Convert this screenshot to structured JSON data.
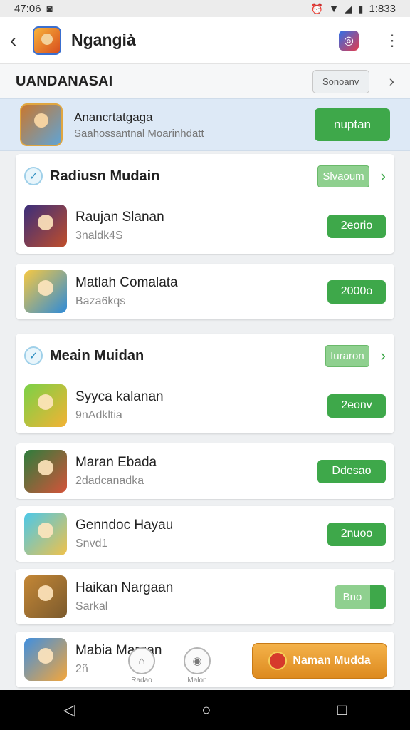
{
  "status": {
    "time": "47:06",
    "battery": "1:833"
  },
  "app_bar": {
    "title": "Ngangià"
  },
  "section": {
    "title": "UANDANASAI",
    "sort_label": "Sonoanv"
  },
  "featured": {
    "title": "Anancrtatgaga",
    "subtitle": "Saahossantnal Moarinhdatt",
    "button": "nuptan"
  },
  "groups": [
    {
      "title": "Radiusn Mudain",
      "badge": "Slvaoum",
      "items": [
        {
          "name": "Raujan Slanan",
          "sub": "3naldk4S",
          "button": "2eorio"
        },
        {
          "name": "Matlah Comalata",
          "sub": "Baza6kqs",
          "button": "2000o"
        }
      ]
    },
    {
      "title": "Meain Muidan",
      "badge": "Iuraron",
      "items": [
        {
          "name": "Syyca kalanan",
          "sub": "9nAdkltia",
          "button": "2eonv"
        },
        {
          "name": "Maran Ebada",
          "sub": "2dadcanadka",
          "button": "Ddesao"
        },
        {
          "name": "Genndoc Hayau",
          "sub": "Snvd1",
          "button": "2nuoo"
        },
        {
          "name": "Haikan Nargaan",
          "sub": "Sarkal",
          "button": "Bno"
        },
        {
          "name": "Mabia Margan",
          "sub": "2ñ"
        }
      ]
    }
  ],
  "float_nav": [
    {
      "label": "Radao"
    },
    {
      "label": "Malon"
    }
  ],
  "cta": {
    "label": "Naman Mudda"
  }
}
